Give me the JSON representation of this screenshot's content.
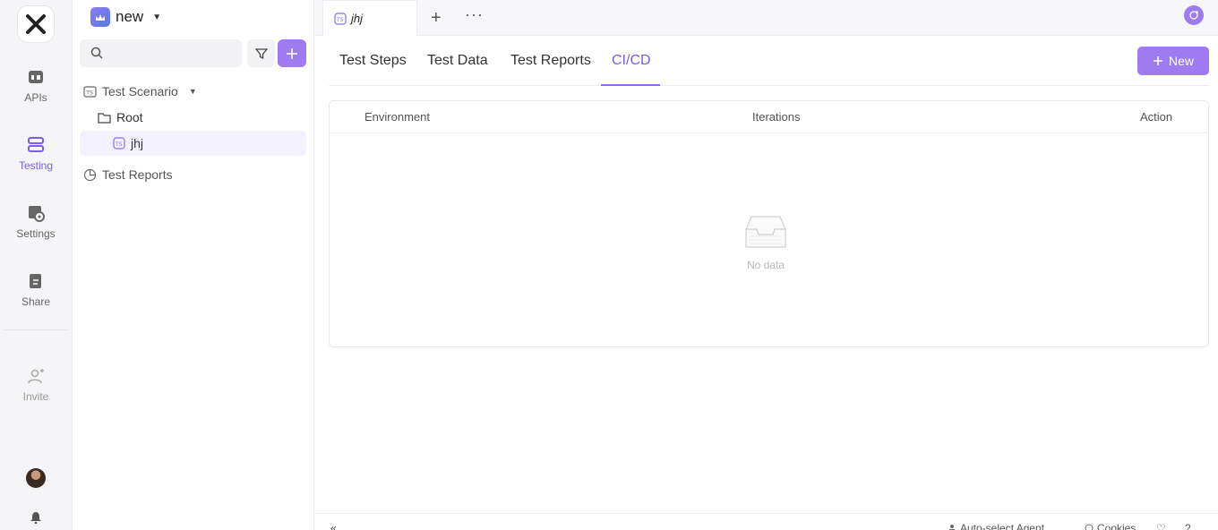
{
  "rail": {
    "items": [
      {
        "label": "APIs",
        "icon": "api-icon"
      },
      {
        "label": "Testing",
        "icon": "testing-icon"
      },
      {
        "label": "Settings",
        "icon": "settings-icon"
      },
      {
        "label": "Share",
        "icon": "share-icon"
      }
    ],
    "invite_label": "Invite"
  },
  "sidebar": {
    "project_name": "new",
    "search_placeholder": "",
    "tree": {
      "scenario": "Test Scenario",
      "root": "Root",
      "item": "jhj",
      "reports": "Test Reports"
    }
  },
  "tabbar": {
    "tab_label": "jhj",
    "plus": "+",
    "more": "···"
  },
  "subtabs": {
    "items": [
      "Test Steps",
      "Test Data",
      "Test Reports",
      "CI/CD"
    ],
    "active": "CI/CD",
    "new_button": "New"
  },
  "table": {
    "columns": [
      "Environment",
      "Iterations",
      "Action"
    ],
    "empty_text": "No data"
  },
  "statusbar": {
    "agent": "Auto-select Agent",
    "cookies": "Cookies"
  },
  "colors": {
    "accent": "#9d7cf2",
    "accent_text": "#7d5ce8",
    "selected_bg": "#f3f0ff"
  }
}
